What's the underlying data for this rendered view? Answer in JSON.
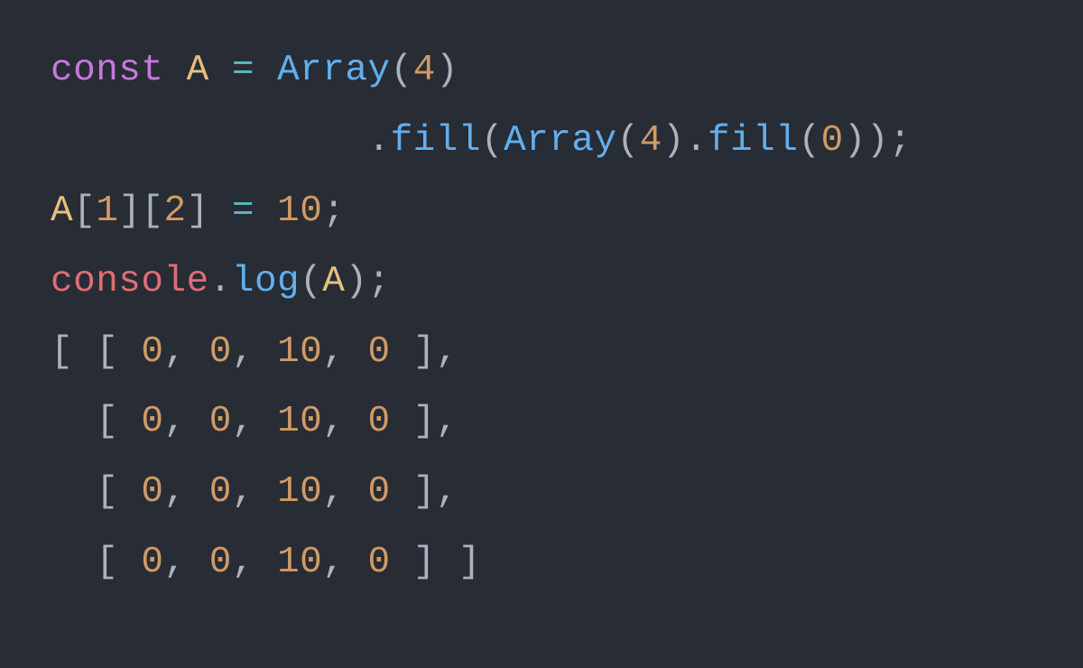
{
  "code": {
    "line1": {
      "kw_const": "const",
      "sp1": " ",
      "ident_A": "A",
      "sp2": " ",
      "eq": "=",
      "sp3": " ",
      "fn_Array": "Array",
      "paren_open": "(",
      "num4": "4",
      "paren_close": ")"
    },
    "line2": {
      "indent": "              ",
      "dot1": ".",
      "fn_fill1": "fill",
      "paren_open1": "(",
      "fn_Array": "Array",
      "paren_open2": "(",
      "num4": "4",
      "paren_close2": ")",
      "dot2": ".",
      "fn_fill2": "fill",
      "paren_open3": "(",
      "num0": "0",
      "paren_close3": ")",
      "paren_close1": ")",
      "semi": ";"
    },
    "line3": {
      "ident_A": "A",
      "br_open1": "[",
      "num1": "1",
      "br_close1": "]",
      "br_open2": "[",
      "num2": "2",
      "br_close2": "]",
      "sp1": " ",
      "eq": "=",
      "sp2": " ",
      "num10": "10",
      "semi": ";"
    },
    "line4": {
      "obj_console": "console",
      "dot": ".",
      "fn_log": "log",
      "paren_open": "(",
      "ident_A": "A",
      "paren_close": ")",
      "semi": ";"
    }
  },
  "output": {
    "rows": [
      {
        "prefix": "[ [ ",
        "v0": "0",
        "c0": ", ",
        "v1": "0",
        "c1": ", ",
        "v2": "10",
        "c2": ", ",
        "v3": "0",
        "suffix": " ],"
      },
      {
        "prefix": "  [ ",
        "v0": "0",
        "c0": ", ",
        "v1": "0",
        "c1": ", ",
        "v2": "10",
        "c2": ", ",
        "v3": "0",
        "suffix": " ],"
      },
      {
        "prefix": "  [ ",
        "v0": "0",
        "c0": ", ",
        "v1": "0",
        "c1": ", ",
        "v2": "10",
        "c2": ", ",
        "v3": "0",
        "suffix": " ],"
      },
      {
        "prefix": "  [ ",
        "v0": "0",
        "c0": ", ",
        "v1": "0",
        "c1": ", ",
        "v2": "10",
        "c2": ", ",
        "v3": "0",
        "suffix": " ] ]"
      }
    ]
  },
  "colors": {
    "background": "#282c34",
    "keyword": "#c678dd",
    "identifier": "#e5c07b",
    "operator": "#56b6c2",
    "function": "#61afef",
    "punctuation": "#abb2bf",
    "number": "#d19a66",
    "object": "#e06c75"
  }
}
